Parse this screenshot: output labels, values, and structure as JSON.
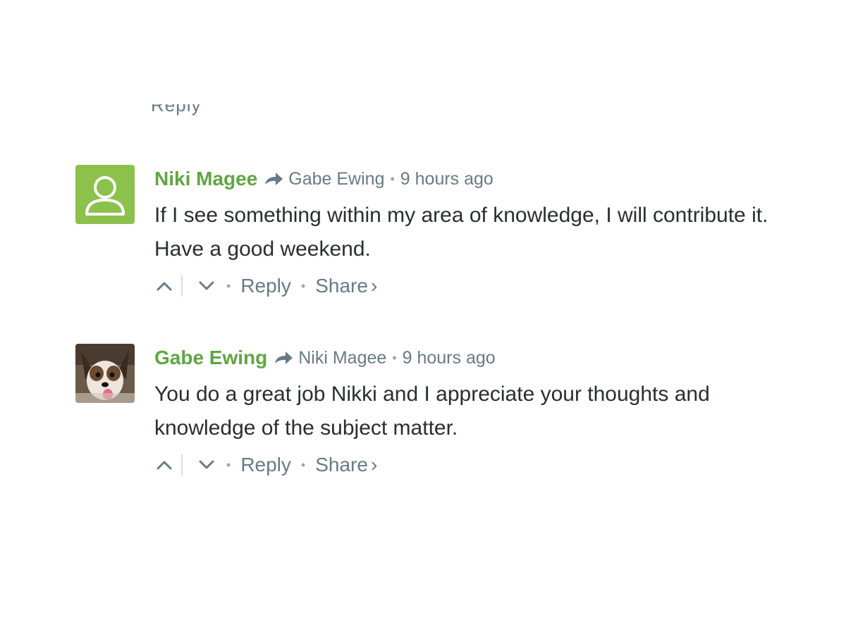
{
  "clipped_previous": {
    "visible_fragment": "Reply"
  },
  "comments": [
    {
      "author": "Niki Magee",
      "reply_to": "Gabe Ewing",
      "time": "9 hours ago",
      "text": "If I see something within my area of knowledge, I will contribute it. Have a good weekend.",
      "avatar": "default-user-avatar",
      "avatar_color": "#8cc14c",
      "actions": {
        "reply": "Reply",
        "share": "Share",
        "share_chevron": "›"
      }
    },
    {
      "author": "Gabe Ewing",
      "reply_to": "Niki Magee",
      "time": "9 hours ago",
      "text": "You do a great job Nikki and I appreciate your thoughts and knowledge of the subject matter.",
      "avatar": "dog-photo-avatar",
      "actions": {
        "reply": "Reply",
        "share": "Share",
        "share_chevron": "›"
      }
    }
  ],
  "colors": {
    "author": "#5fa641",
    "meta": "#687a86",
    "text": "#2a2e2e"
  }
}
